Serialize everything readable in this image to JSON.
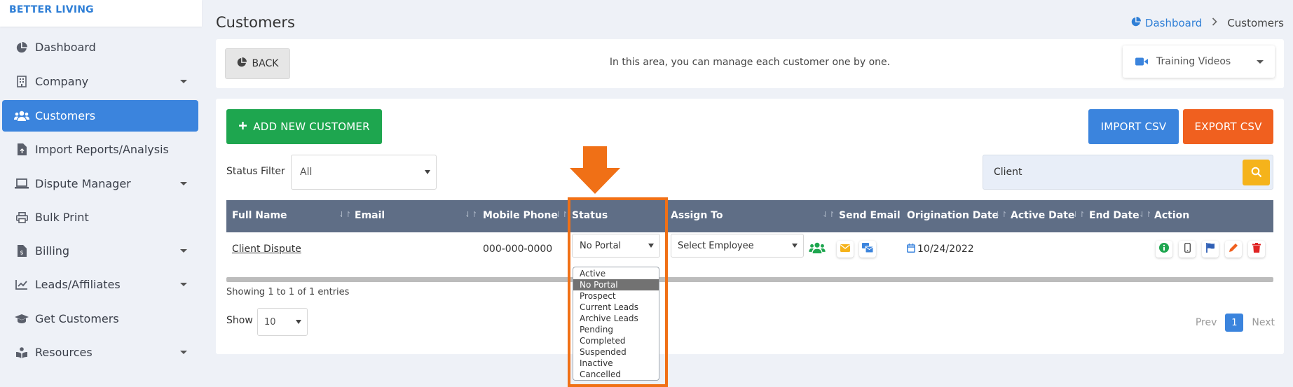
{
  "brand": "BETTER LIVING",
  "sidebar": {
    "items": [
      {
        "label": "Dashboard",
        "icon": "pie-chart-icon",
        "active": false,
        "has_caret": false
      },
      {
        "label": "Company",
        "icon": "building-icon",
        "active": false,
        "has_caret": true
      },
      {
        "label": "Customers",
        "icon": "users-icon",
        "active": true,
        "has_caret": false
      },
      {
        "label": "Import Reports/Analysis",
        "icon": "file-import-icon",
        "active": false,
        "has_caret": false
      },
      {
        "label": "Dispute Manager",
        "icon": "laptop-icon",
        "active": false,
        "has_caret": true
      },
      {
        "label": "Bulk Print",
        "icon": "printer-icon",
        "active": false,
        "has_caret": false
      },
      {
        "label": "Billing",
        "icon": "invoice-icon",
        "active": false,
        "has_caret": true
      },
      {
        "label": "Leads/Affiliates",
        "icon": "line-chart-icon",
        "active": false,
        "has_caret": true
      },
      {
        "label": "Get Customers",
        "icon": "graduation-cap-icon",
        "active": false,
        "has_caret": false
      },
      {
        "label": "Resources",
        "icon": "book-reader-icon",
        "active": false,
        "has_caret": true
      }
    ]
  },
  "header": {
    "title": "Customers",
    "breadcrumb": {
      "home": "Dashboard",
      "current": "Customers"
    }
  },
  "infobar": {
    "back_label": "BACK",
    "message": "In this area, you can manage each customer one by one.",
    "training_label": "Training Videos"
  },
  "toolbar": {
    "add_label": "ADD NEW CUSTOMER",
    "import_label": "IMPORT CSV",
    "export_label": "EXPORT CSV",
    "status_filter_label": "Status Filter",
    "status_filter_value": "All",
    "search_value": "Client"
  },
  "table": {
    "columns": [
      "Full Name",
      "Email",
      "Mobile Phone",
      "Status",
      "Assign To",
      "Send Email",
      "Origination Date",
      "Active Date",
      "End Date",
      "Action"
    ],
    "rows": [
      {
        "full_name": "Client Dispute",
        "email": "",
        "mobile": "000-000-0000",
        "status": "No Portal",
        "assign_to": "Select Employee",
        "origination_date": "10/24/2022",
        "active_date": "",
        "end_date": ""
      }
    ]
  },
  "status_options": [
    "Active",
    "No Portal",
    "Prospect",
    "Current Leads",
    "Archive Leads",
    "Pending",
    "Completed",
    "Suspended",
    "Inactive",
    "Cancelled"
  ],
  "status_selected_index": 1,
  "footer": {
    "showing": "Showing 1 to 1 of 1 entries",
    "show_label": "Show",
    "page_size": "10",
    "prev": "Prev",
    "page": "1",
    "next": "Next"
  },
  "colors": {
    "primary": "#3b84dd",
    "success": "#1ea64f",
    "danger": "#f0601f",
    "header_bg": "#5f6e86",
    "highlight": "#f07016"
  }
}
